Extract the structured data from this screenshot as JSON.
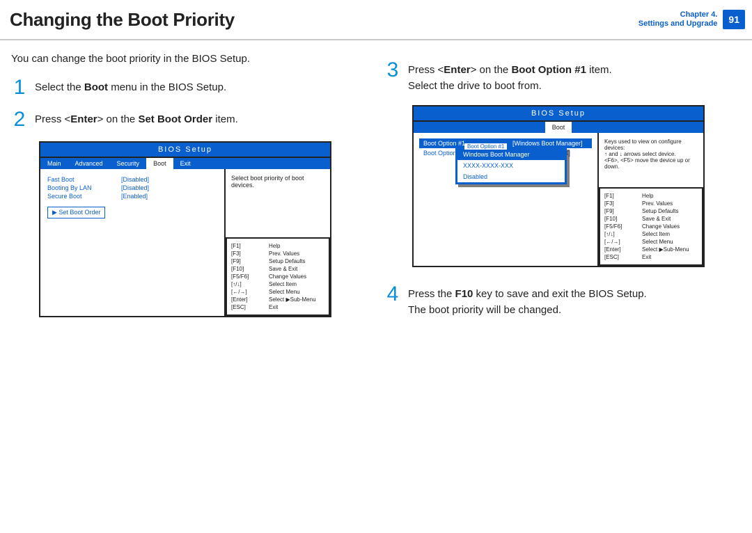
{
  "header": {
    "title": "Changing the Boot Priority",
    "chapter_line1": "Chapter 4.",
    "chapter_line2": "Settings and Upgrade",
    "page_number": "91"
  },
  "intro": "You can change the boot priority in the BIOS Setup.",
  "steps": {
    "s1": {
      "num": "1",
      "before": "Select the ",
      "bold": "Boot",
      "after": " menu in the BIOS Setup."
    },
    "s2": {
      "num": "2",
      "before": "Press <",
      "bold_key": "Enter",
      "mid": "> on the ",
      "bold_item": "Set Boot Order",
      "after": " item."
    },
    "s3": {
      "num": "3",
      "before": "Press <",
      "bold_key": "Enter",
      "mid": "> on the ",
      "bold_item": "Boot Option #1",
      "after": " item.",
      "line2": "Select the drive to boot from."
    },
    "s4": {
      "num": "4",
      "before": "Press the ",
      "bold": "F10",
      "after": " key to save and exit the BIOS Setup.",
      "line2": "The boot priority will be changed."
    }
  },
  "bios1": {
    "title": "BIOS Setup",
    "tabs": [
      "Main",
      "Advanced",
      "Security",
      "Boot",
      "Exit"
    ],
    "active_tab": "Boot",
    "rows": [
      {
        "k": "Fast Boot",
        "v": "[Disabled]"
      },
      {
        "k": "Booting By LAN",
        "v": "[Disabled]"
      },
      {
        "k": "Secure Boot",
        "v": "[Enabled]"
      }
    ],
    "selected_row": "▶ Set Boot Order",
    "side_text": "Select boot priority of boot devices.",
    "help": [
      {
        "k": "[F1]",
        "v": "Help"
      },
      {
        "k": "[F3]",
        "v": "Prev. Values"
      },
      {
        "k": "[F9]",
        "v": "Setup Defaults"
      },
      {
        "k": "[F10]",
        "v": "Save & Exit"
      },
      {
        "k": "[F5/F6]",
        "v": "Change Values"
      },
      {
        "k": "[↑/↓]",
        "v": "Select Item"
      },
      {
        "k": "[←/→]",
        "v": "Select Menu"
      },
      {
        "k": "[Enter]",
        "v": "Select ▶Sub-Menu"
      },
      {
        "k": "[ESC]",
        "v": "Exit"
      }
    ]
  },
  "bios2": {
    "title": "BIOS Setup",
    "tab": "Boot",
    "rows": [
      {
        "k": "Boot Option #1",
        "v": "[Windows Boot Manager]",
        "hl": true
      },
      {
        "k": "Boot Option #2",
        "v": "[XXXX-XXXX-XXXX]",
        "hl": false
      }
    ],
    "side_text": "Keys used to view on configure devices:\n↑  and  ↓  arrows select device.\n<F6>, <F5> move the device up or down.",
    "popup": {
      "legend": "Boot Option #1",
      "items": [
        "Windows Boot Manager",
        "XXXX-XXXX-XXX",
        "Disabled"
      ],
      "selected": "Windows Boot Manager"
    },
    "help": [
      {
        "k": "[F1]",
        "v": "Help"
      },
      {
        "k": "[F3]",
        "v": "Prev. Values"
      },
      {
        "k": "[F9]",
        "v": "Setup Defaults"
      },
      {
        "k": "[F10]",
        "v": "Save & Exit"
      },
      {
        "k": "[F5/F6]",
        "v": "Change Values"
      },
      {
        "k": "[↑/↓]",
        "v": "Select Item"
      },
      {
        "k": "[←/→]",
        "v": "Select Menu"
      },
      {
        "k": "[Enter]",
        "v": "Select ▶Sub-Menu"
      },
      {
        "k": "[ESC]",
        "v": "Exit"
      }
    ]
  }
}
